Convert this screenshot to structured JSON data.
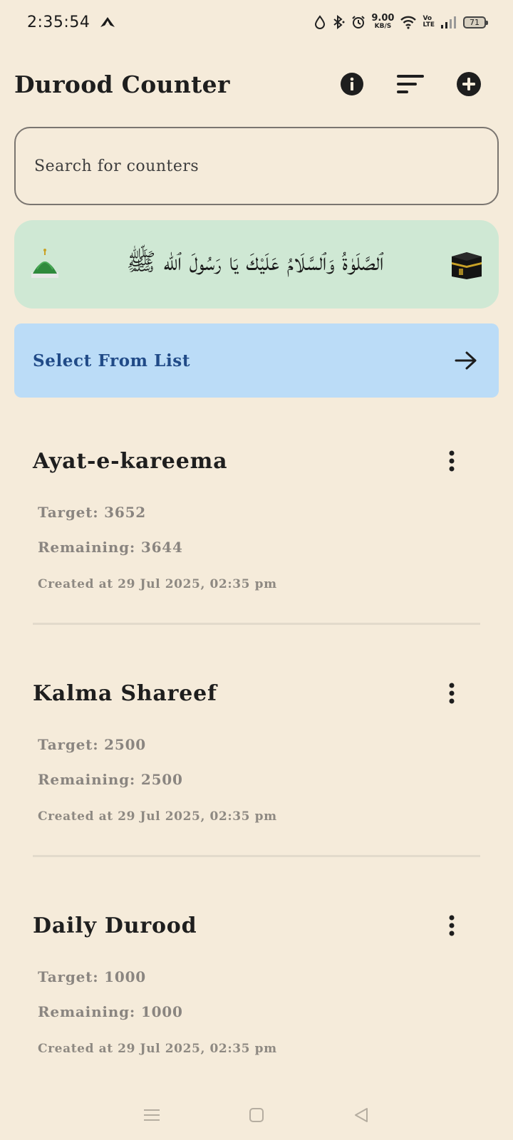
{
  "status_bar": {
    "time": "2:35:54",
    "net_speed_value": "9.00",
    "net_speed_unit": "KB/S",
    "volte_top": "Vo",
    "volte_bottom": "LTE",
    "battery": "71"
  },
  "header": {
    "title": "Durood Counter",
    "icons": [
      "info-icon",
      "sort-icon",
      "add-circle-icon"
    ]
  },
  "search": {
    "placeholder": "Search for counters",
    "value": ""
  },
  "banner": {
    "text": "ٱلصَّلَوٰةُ وَٱلسَّلَامُ عَلَيْكَ يَا رَسُولَ ٱللّٰه ﷺ",
    "left_icon": "green-dome-icon",
    "right_icon": "kaaba-icon"
  },
  "select_list": {
    "label": "Select From List",
    "icon": "arrow-right-icon"
  },
  "counters": [
    {
      "title": "Ayat-e-kareema",
      "target_label": "Target: 3652",
      "remaining_label": "Remaining: 3644",
      "created": "Created at 29 Jul 2025, 02:35 pm"
    },
    {
      "title": "Kalma Shareef",
      "target_label": "Target: 2500",
      "remaining_label": "Remaining: 2500",
      "created": "Created at 29 Jul 2025, 02:35 pm"
    },
    {
      "title": "Daily Durood",
      "target_label": "Target: 1000",
      "remaining_label": "Remaining: 1000",
      "created": "Created at 29 Jul 2025, 02:35 pm"
    }
  ],
  "nav_bar": {
    "icons": [
      "menu-nav-icon",
      "home-nav-icon",
      "back-nav-icon"
    ]
  },
  "colors": {
    "background": "#f5ebda",
    "banner_bg": "#cfe8d4",
    "select_bg": "#bbdcf7",
    "select_text": "#204a87",
    "muted_text": "#8a8580"
  }
}
